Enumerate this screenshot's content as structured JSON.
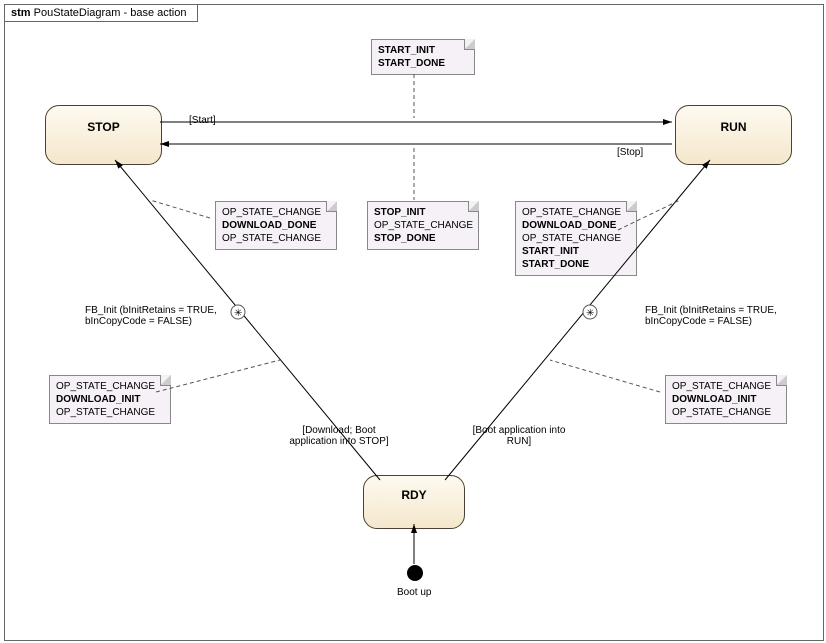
{
  "title_kw": "stm",
  "title": "PouStateDiagram - base action",
  "states": {
    "stop": "STOP",
    "run": "RUN",
    "rdy": "RDY"
  },
  "init_label": "Boot up",
  "transitions": {
    "start": "[Start]",
    "stop": "[Stop]",
    "dl_stop": "[Download; Boot\napplication into STOP]",
    "boot_run": "[Boot application into\nRUN]",
    "fb_left": "FB_Init (bInitRetains = TRUE,\nbInCopyCode = FALSE)",
    "fb_right": "FB_Init (bInitRetains = TRUE,\nbInCopyCode = FALSE)"
  },
  "notes": {
    "top": [
      "START_INIT",
      "START_DONE"
    ],
    "mid": [
      "STOP_INIT",
      "OP_STATE_CHANGE",
      "STOP_DONE"
    ],
    "nLeftUpper": [
      "OP_STATE_CHANGE",
      "DOWNLOAD_DONE",
      "OP_STATE_CHANGE"
    ],
    "nRightUpper": [
      "OP_STATE_CHANGE",
      "DOWNLOAD_DONE",
      "OP_STATE_CHANGE",
      "START_INIT",
      "START_DONE"
    ],
    "nLeftLower": [
      "OP_STATE_CHANGE",
      "DOWNLOAD_INIT",
      "OP_STATE_CHANGE"
    ],
    "nRightLower": [
      "OP_STATE_CHANGE",
      "DOWNLOAD_INIT",
      "OP_STATE_CHANGE"
    ]
  }
}
